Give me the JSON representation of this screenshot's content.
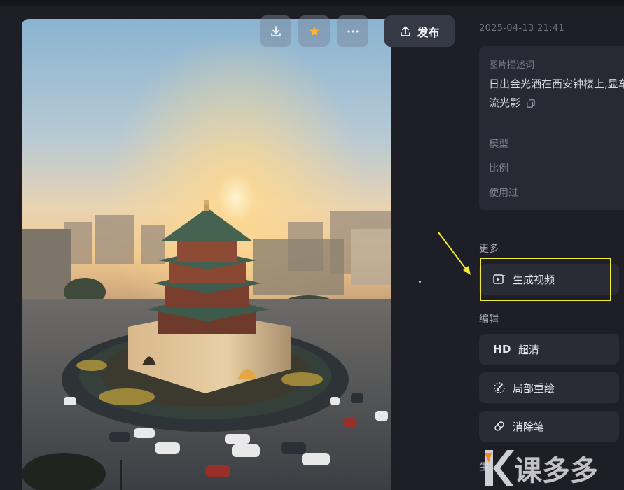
{
  "toolbar": {
    "download_icon": "download-icon",
    "favorite_icon": "star-icon",
    "more_icon": "more-icon",
    "publish_label": "发布"
  },
  "timestamp": "2025-04-13 21:41",
  "info": {
    "desc_label": "图片描述词",
    "desc_text": "日出金光洒在西安钟楼上,显车流光影",
    "model_label": "模型",
    "ratio_label": "比例",
    "used_label": "使用过"
  },
  "sections": {
    "more": "更多",
    "edit": "编辑",
    "gen_partial": "生"
  },
  "actions": {
    "generate_video": "生成视频",
    "hd_badge": "HD",
    "upscale": "超清",
    "inpaint": "局部重绘",
    "eraser": "消除笔"
  },
  "watermark": "课多多",
  "colors": {
    "background": "#1e1f26",
    "card": "#282a33",
    "highlight": "#f2ea38",
    "star": "#f5b83d"
  }
}
